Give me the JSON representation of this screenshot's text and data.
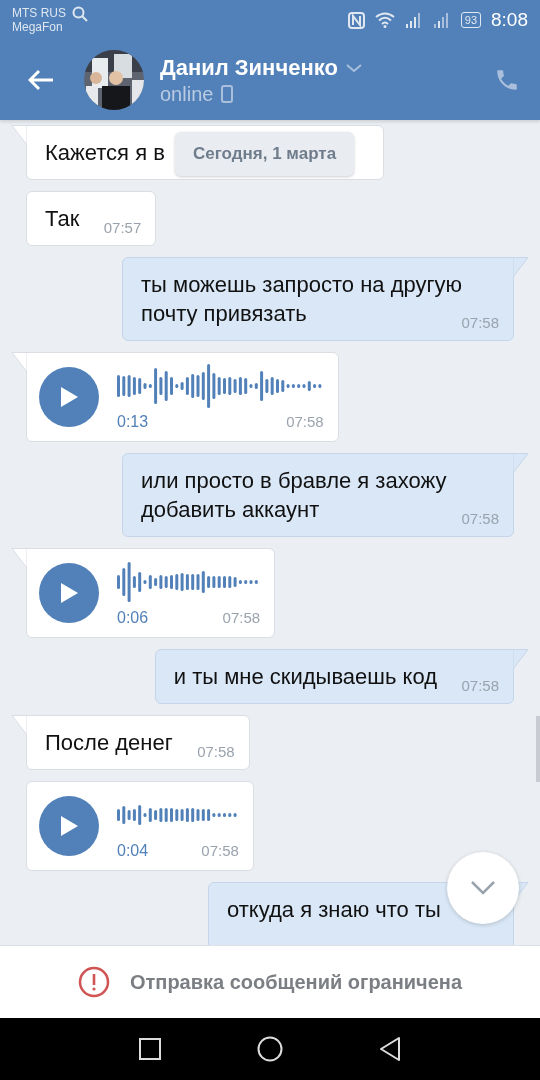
{
  "status_bar": {
    "carriers": [
      "MTS RUS",
      "MegaFon"
    ],
    "battery": "93",
    "time": "8:08"
  },
  "header": {
    "name": "Данил Зинченко",
    "status": "online"
  },
  "date_pill": "Сегодня, 1 марта",
  "messages": [
    {
      "kind": "text",
      "outgoing": false,
      "tail": true,
      "text": "Кажется я в"
    },
    {
      "kind": "text",
      "outgoing": false,
      "tail": false,
      "text": "Так",
      "time": "07:57"
    },
    {
      "kind": "text",
      "outgoing": true,
      "tail": true,
      "text": "ты можешь запросто на другую почту привязать",
      "time": "07:58"
    },
    {
      "kind": "voice",
      "outgoing": false,
      "tail": true,
      "duration": "0:13",
      "time": "07:58"
    },
    {
      "kind": "text",
      "outgoing": true,
      "tail": true,
      "text": "или просто в бравле я захожу добавить аккаунт",
      "time": "07:58"
    },
    {
      "kind": "voice",
      "outgoing": false,
      "tail": true,
      "duration": "0:06",
      "time": "07:58"
    },
    {
      "kind": "text",
      "outgoing": true,
      "tail": true,
      "text": "и ты мне скидываешь код",
      "time": "07:58"
    },
    {
      "kind": "text",
      "outgoing": false,
      "tail": true,
      "text": "После денег",
      "time": "07:58"
    },
    {
      "kind": "voice",
      "outgoing": false,
      "tail": false,
      "duration": "0:04",
      "time": "07:58"
    },
    {
      "kind": "text",
      "outgoing": true,
      "tail": true,
      "text": "откуда я знаю что ты"
    }
  ],
  "notice": "Отправка сообщений ограничена"
}
